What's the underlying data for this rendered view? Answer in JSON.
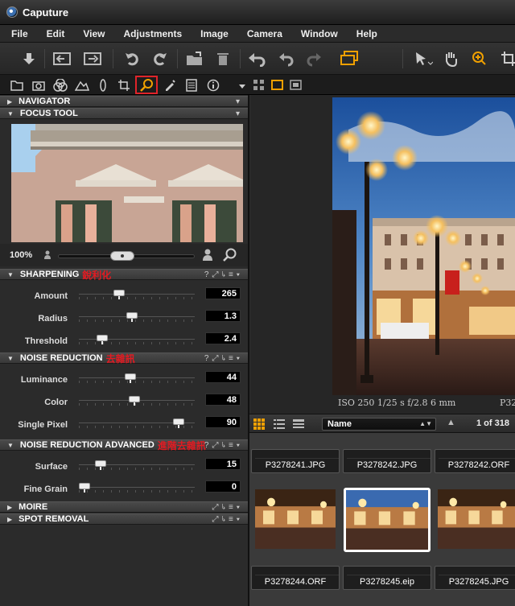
{
  "window": {
    "title": "Caputure"
  },
  "menu": [
    "File",
    "Edit",
    "View",
    "Adjustments",
    "Image",
    "Camera",
    "Window",
    "Help"
  ],
  "sections": {
    "navigator": "NAVIGATOR",
    "focus_tool": "FOCUS TOOL",
    "sharpening": {
      "title": "SHARPENING",
      "cn": "銳利化"
    },
    "noise_reduction": {
      "title": "NOISE REDUCTION",
      "cn": "去雜訊"
    },
    "noise_reduction_adv": {
      "title": "NOISE REDUCTION ADVANCED",
      "cn": "進階去雜訊"
    },
    "moire": "MOIRE",
    "spot_removal": "SPOT REMOVAL"
  },
  "zoom": {
    "label": "100%",
    "level": 0.5
  },
  "sharpening": [
    {
      "label": "Amount",
      "value": "265",
      "pos": 0.33
    },
    {
      "label": "Radius",
      "value": "1.3",
      "pos": 0.45
    },
    {
      "label": "Threshold",
      "value": "2.4",
      "pos": 0.17
    }
  ],
  "noise": [
    {
      "label": "Luminance",
      "value": "44",
      "pos": 0.44
    },
    {
      "label": "Color",
      "value": "48",
      "pos": 0.48
    },
    {
      "label": "Single Pixel",
      "value": "90",
      "pos": 0.9
    }
  ],
  "noise_adv": [
    {
      "label": "Surface",
      "value": "15",
      "pos": 0.15
    },
    {
      "label": "Fine Grain",
      "value": "0",
      "pos": 0.0
    }
  ],
  "viewer": {
    "exif": "ISO 250  1/25 s  f/2.8  6 mm",
    "exif_right": "P32"
  },
  "browser": {
    "sort": "Name",
    "count": "1 of 318"
  },
  "thumbs_top": [
    "P3278241.JPG",
    "P3278242.JPG",
    "P3278242.ORF"
  ],
  "thumbs_bottom": [
    "P3278244.ORF",
    "P3278245.eip",
    "P3278245.JPG"
  ],
  "colors": {
    "accent": "#e0242a",
    "zoom_icon": "#f0a000",
    "cn_label": "#e21b22"
  }
}
